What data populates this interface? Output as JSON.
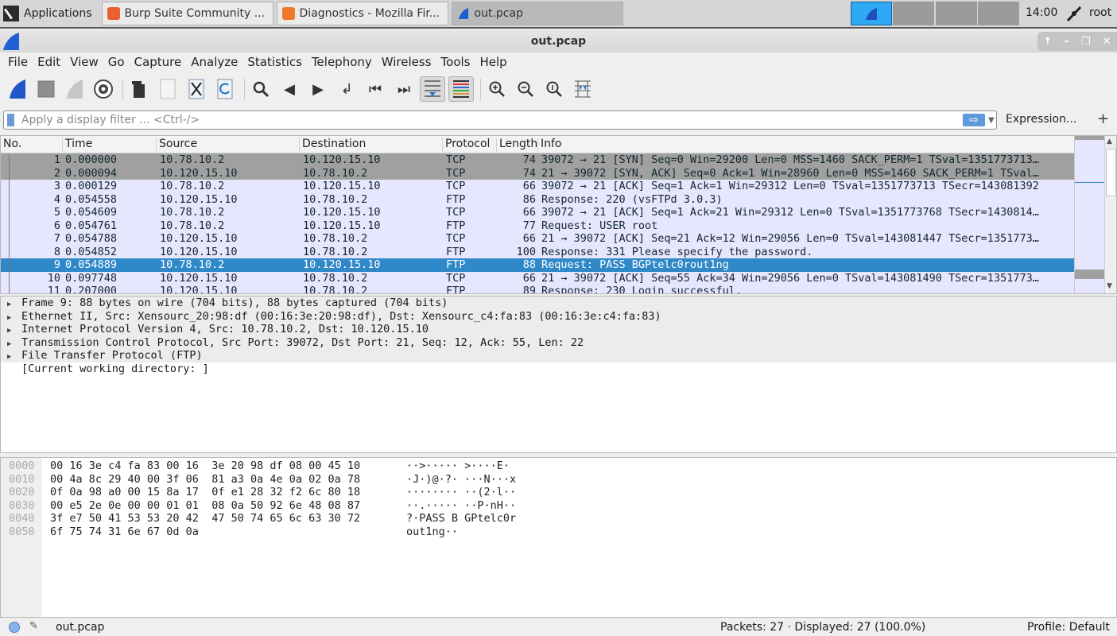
{
  "taskbar": {
    "applications_label": "Applications",
    "tasks": [
      {
        "label": "Burp Suite Community ...",
        "icon": "burp-icon",
        "color": "#e8602b"
      },
      {
        "label": "Diagnostics - Mozilla Fir...",
        "icon": "firefox-icon",
        "color": "#f0782b"
      },
      {
        "label": "out.pcap",
        "icon": "wireshark-icon",
        "color": "#1e5fd0"
      }
    ],
    "clock": "14:00",
    "user": "root"
  },
  "window": {
    "title": "out.pcap"
  },
  "menu": [
    "File",
    "Edit",
    "View",
    "Go",
    "Capture",
    "Analyze",
    "Statistics",
    "Telephony",
    "Wireless",
    "Tools",
    "Help"
  ],
  "toolbar": {
    "icons": [
      "start-capture-icon",
      "stop-capture-icon",
      "restart-capture-icon",
      "capture-options-icon",
      "open-file-icon",
      "save-file-icon",
      "close-file-icon",
      "reload-file-icon",
      "find-packet-icon",
      "go-back-icon",
      "go-forward-icon",
      "go-to-packet-icon",
      "first-packet-icon",
      "last-packet-icon",
      "autoscroll-icon",
      "colorize-icon",
      "zoom-in-icon",
      "zoom-out-icon",
      "normal-size-icon",
      "resize-columns-icon"
    ]
  },
  "filter": {
    "placeholder": "Apply a display filter ... <Ctrl-/>",
    "value": "",
    "expression_label": "Expression...",
    "add_label": "+"
  },
  "packet_list": {
    "columns": [
      "No.",
      "Time",
      "Source",
      "Destination",
      "Protocol",
      "Length",
      "Info"
    ],
    "rows": [
      {
        "no": "1",
        "time": "0.000000",
        "src": "10.78.10.2",
        "dst": "10.120.15.10",
        "proto": "TCP",
        "len": "74",
        "info": "39072 → 21 [SYN] Seq=0 Win=29200 Len=0 MSS=1460 SACK_PERM=1 TSval=1351773713…",
        "style": "syn"
      },
      {
        "no": "2",
        "time": "0.000094",
        "src": "10.120.15.10",
        "dst": "10.78.10.2",
        "proto": "TCP",
        "len": "74",
        "info": "21 → 39072 [SYN, ACK] Seq=0 Ack=1 Win=28960 Len=0 MSS=1460 SACK_PERM=1 TSval…",
        "style": "syn"
      },
      {
        "no": "3",
        "time": "0.000129",
        "src": "10.78.10.2",
        "dst": "10.120.15.10",
        "proto": "TCP",
        "len": "66",
        "info": "39072 → 21 [ACK] Seq=1 Ack=1 Win=29312 Len=0 TSval=1351773713 TSecr=143081392",
        "style": "normal"
      },
      {
        "no": "4",
        "time": "0.054558",
        "src": "10.120.15.10",
        "dst": "10.78.10.2",
        "proto": "FTP",
        "len": "86",
        "info": "Response: 220 (vsFTPd 3.0.3)",
        "style": "normal"
      },
      {
        "no": "5",
        "time": "0.054609",
        "src": "10.78.10.2",
        "dst": "10.120.15.10",
        "proto": "TCP",
        "len": "66",
        "info": "39072 → 21 [ACK] Seq=1 Ack=21 Win=29312 Len=0 TSval=1351773768 TSecr=1430814…",
        "style": "normal"
      },
      {
        "no": "6",
        "time": "0.054761",
        "src": "10.78.10.2",
        "dst": "10.120.15.10",
        "proto": "FTP",
        "len": "77",
        "info": "Request: USER root",
        "style": "normal"
      },
      {
        "no": "7",
        "time": "0.054788",
        "src": "10.120.15.10",
        "dst": "10.78.10.2",
        "proto": "TCP",
        "len": "66",
        "info": "21 → 39072 [ACK] Seq=21 Ack=12 Win=29056 Len=0 TSval=143081447 TSecr=1351773…",
        "style": "normal"
      },
      {
        "no": "8",
        "time": "0.054852",
        "src": "10.120.15.10",
        "dst": "10.78.10.2",
        "proto": "FTP",
        "len": "100",
        "info": "Response: 331 Please specify the password.",
        "style": "normal"
      },
      {
        "no": "9",
        "time": "0.054889",
        "src": "10.78.10.2",
        "dst": "10.120.15.10",
        "proto": "FTP",
        "len": "88",
        "info": "Request: PASS BGPtelc0rout1ng",
        "style": "sel"
      },
      {
        "no": "10",
        "time": "0.097748",
        "src": "10.120.15.10",
        "dst": "10.78.10.2",
        "proto": "TCP",
        "len": "66",
        "info": "21 → 39072 [ACK] Seq=55 Ack=34 Win=29056 Len=0 TSval=143081490 TSecr=1351773…",
        "style": "normal"
      },
      {
        "no": "11",
        "time": "0.207000",
        "src": "10.120.15.10",
        "dst": "10.78.10.2",
        "proto": "FTP",
        "len": "89",
        "info": "Response: 230 Login successful.",
        "style": "normal"
      }
    ]
  },
  "details": [
    {
      "text": "Frame 9: 88 bytes on wire (704 bits), 88 bytes captured (704 bits)",
      "expandable": true
    },
    {
      "text": "Ethernet II, Src: Xensourc_20:98:df (00:16:3e:20:98:df), Dst: Xensourc_c4:fa:83 (00:16:3e:c4:fa:83)",
      "expandable": true
    },
    {
      "text": "Internet Protocol Version 4, Src: 10.78.10.2, Dst: 10.120.15.10",
      "expandable": true
    },
    {
      "text": "Transmission Control Protocol, Src Port: 39072, Dst Port: 21, Seq: 12, Ack: 55, Len: 22",
      "expandable": true
    },
    {
      "text": "File Transfer Protocol (FTP)",
      "expandable": true
    },
    {
      "text": "[Current working directory: ]",
      "expandable": false
    }
  ],
  "bytes": [
    {
      "offset": "0000",
      "hex": "00 16 3e c4 fa 83 00 16  3e 20 98 df 08 00 45 10",
      "ascii": "··>····· >····E·"
    },
    {
      "offset": "0010",
      "hex": "00 4a 8c 29 40 00 3f 06  81 a3 0a 4e 0a 02 0a 78",
      "ascii": "·J·)@·?· ···N···x"
    },
    {
      "offset": "0020",
      "hex": "0f 0a 98 a0 00 15 8a 17  0f e1 28 32 f2 6c 80 18",
      "ascii": "········ ··(2·l··"
    },
    {
      "offset": "0030",
      "hex": "00 e5 2e 0e 00 00 01 01  08 0a 50 92 6e 48 08 87",
      "ascii": "··.····· ··P·nH··"
    },
    {
      "offset": "0040",
      "hex": "3f e7 50 41 53 53 20 42  47 50 74 65 6c 63 30 72",
      "ascii": "?·PASS B GPtelc0r"
    },
    {
      "offset": "0050",
      "hex": "6f 75 74 31 6e 67 0d 0a",
      "ascii": "out1ng··"
    }
  ],
  "status": {
    "file": "out.pcap",
    "packets": "Packets: 27 · Displayed: 27 (100.0%)",
    "profile": "Profile: Default"
  }
}
